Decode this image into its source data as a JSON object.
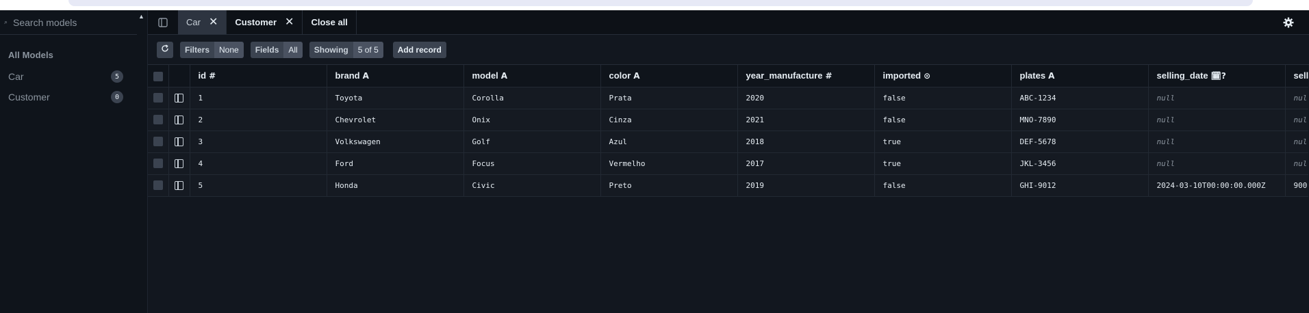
{
  "sidebar": {
    "search_placeholder": "Search models",
    "heading": "All Models",
    "items": [
      {
        "label": "Car",
        "count": "5"
      },
      {
        "label": "Customer",
        "count": "0"
      }
    ]
  },
  "tabs": [
    {
      "label": "Car",
      "active": true
    },
    {
      "label": "Customer",
      "active": false
    }
  ],
  "close_all_label": "Close all",
  "toolbar": {
    "filters_label": "Filters",
    "filters_value": "None",
    "fields_label": "Fields",
    "fields_value": "All",
    "showing_label": "Showing",
    "showing_value": "5 of 5",
    "add_record_label": "Add record"
  },
  "table": {
    "columns": [
      {
        "name": "id",
        "type_icon": "#"
      },
      {
        "name": "brand",
        "type_icon": "A"
      },
      {
        "name": "model",
        "type_icon": "A"
      },
      {
        "name": "color",
        "type_icon": "A"
      },
      {
        "name": "year_manufacture",
        "type_icon": "#"
      },
      {
        "name": "imported",
        "type_icon": "⊙"
      },
      {
        "name": "plates",
        "type_icon": "A"
      },
      {
        "name": "selling_date",
        "type_icon": "🗓?"
      },
      {
        "name": "sell",
        "type_icon": ""
      }
    ],
    "rows": [
      [
        "1",
        "Toyota",
        "Corolla",
        "Prata",
        "2020",
        "false",
        "ABC-1234",
        "null",
        "nul"
      ],
      [
        "2",
        "Chevrolet",
        "Onix",
        "Cinza",
        "2021",
        "false",
        "MNO-7890",
        "null",
        "nul"
      ],
      [
        "3",
        "Volkswagen",
        "Golf",
        "Azul",
        "2018",
        "true",
        "DEF-5678",
        "null",
        "nul"
      ],
      [
        "4",
        "Ford",
        "Focus",
        "Vermelho",
        "2017",
        "true",
        "JKL-3456",
        "null",
        "nul"
      ],
      [
        "5",
        "Honda",
        "Civic",
        "Preto",
        "2019",
        "false",
        "GHI-9012",
        "2024-03-10T00:00:00.000Z",
        "900"
      ]
    ]
  },
  "colors": {
    "background": "#0d1117",
    "panel": "#12171f",
    "badge": "#3b4350",
    "active_tab": "#2d3440"
  }
}
